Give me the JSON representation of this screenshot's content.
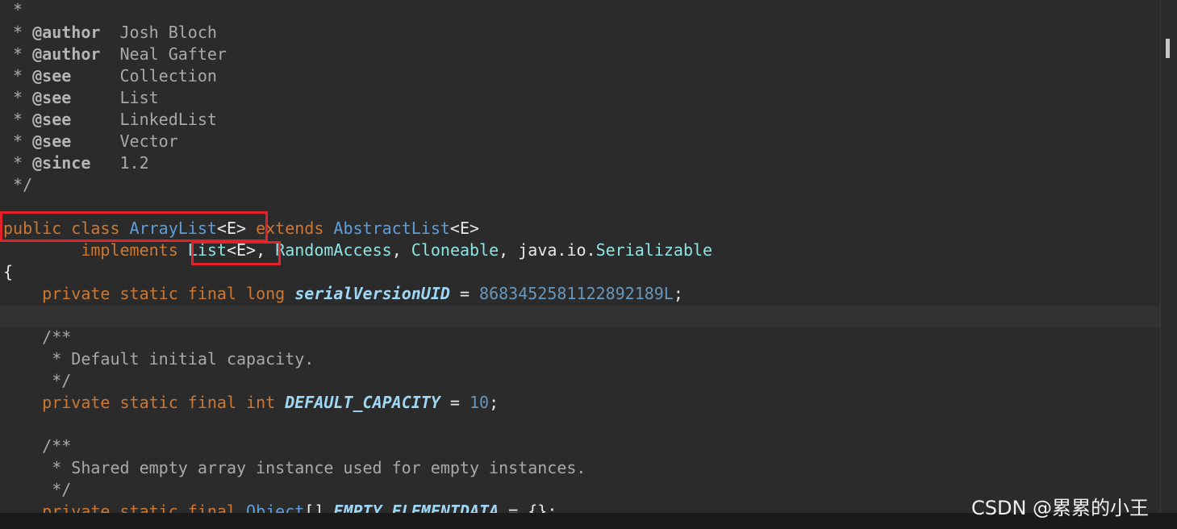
{
  "code": {
    "javadoc_tail": {
      "star": " *",
      "author1": {
        "prefix": " * ",
        "tag": "@author",
        "text": "  Josh Bloch"
      },
      "author2": {
        "prefix": " * ",
        "tag": "@author",
        "text": "  Neal Gafter"
      },
      "see1": {
        "prefix": " * ",
        "tag": "@see",
        "text": "     Collection"
      },
      "see2": {
        "prefix": " * ",
        "tag": "@see",
        "text": "     List"
      },
      "see3": {
        "prefix": " * ",
        "tag": "@see",
        "text": "     LinkedList"
      },
      "see4": {
        "prefix": " * ",
        "tag": "@see",
        "text": "     Vector"
      },
      "since": {
        "prefix": " * ",
        "tag": "@since",
        "text": "   1.2"
      },
      "close": " */"
    },
    "class_decl": {
      "kw": "public class ",
      "name": "ArrayList",
      "generic": "<E>",
      "extends_kw": " extends ",
      "superclass": "AbstractList",
      "super_generic": "<E>"
    },
    "implements_line": {
      "indent": "        ",
      "kw": "implements",
      "list": "List",
      "list_generic": "<E>",
      "comma1": ", ",
      "random_access": "RandomAccess",
      "comma2": ", ",
      "cloneable": "Cloneable",
      "comma3": ", ",
      "serializable_pkg": "java.io.",
      "serializable": "Serializable"
    },
    "open_brace": "{",
    "serial_line": {
      "indent": "    ",
      "kw": "private static final long ",
      "field": "serialVersionUID",
      "eq": " = ",
      "value": "8683452581122892189L",
      "semi": ";"
    },
    "doc1": {
      "open": "    /**",
      "body": "     * Default initial capacity.",
      "close": "     */"
    },
    "capacity_line": {
      "indent": "    ",
      "kw": "private static final int ",
      "field": "DEFAULT_CAPACITY",
      "eq": " = ",
      "value": "10",
      "semi": ";"
    },
    "doc2": {
      "open": "    /**",
      "body": "     * Shared empty array instance used for empty instances.",
      "close": "     */"
    },
    "empty_line": {
      "indent": "    ",
      "kw": "private static final ",
      "type": "Object",
      "brackets": "[] ",
      "field": "EMPTY_ELEMENTDATA",
      "rest": " = {};"
    }
  },
  "watermark": "CSDN @累累的小王",
  "colors": {
    "background": "#2b2b2b",
    "keyword": "#cc7832",
    "type": "#5c9fdc",
    "comment": "#a9a9a9",
    "highlight_box": "#e3232a"
  }
}
